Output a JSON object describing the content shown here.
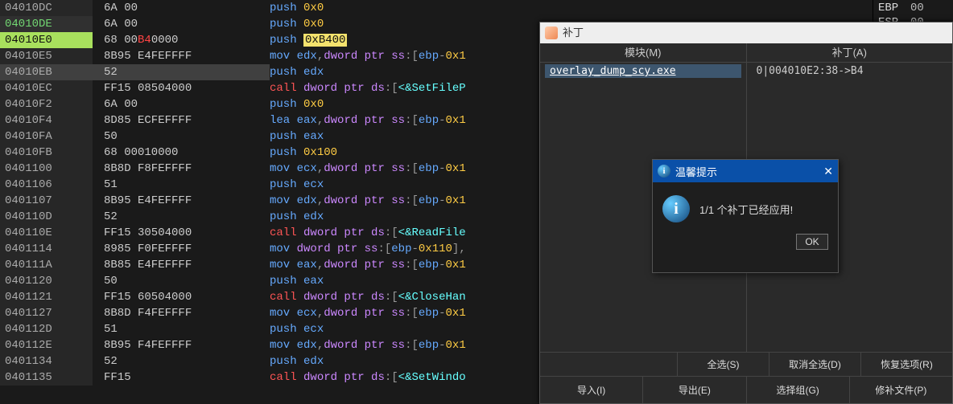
{
  "registers": [
    {
      "name": "EBP",
      "val": "00"
    },
    {
      "name": "ESP",
      "val": "00"
    }
  ],
  "rows": [
    {
      "addr": "04010DC",
      "bytes": "6A 00",
      "mn": "push",
      "op": "0x0",
      "cls": ""
    },
    {
      "addr": "04010DE",
      "bytes": "6A 00",
      "mn": "push",
      "op": "0x0",
      "cls": "bpline"
    },
    {
      "addr": "04010E0",
      "bytes_pre": "68 00",
      "bytes_red": "B4",
      "bytes_post": "0000",
      "mn": "push",
      "op_hl": "0xB400",
      "cls": "hl"
    },
    {
      "addr": "04010E5",
      "bytes": "8B95 E4FEFFFF",
      "mn": "mov",
      "op_mov": "edx,dword ptr ss:[ebp-0x1",
      "cls": ""
    },
    {
      "addr": "04010EB",
      "bytes": "52",
      "mn": "push",
      "op_reg": "edx",
      "cls": "sel"
    },
    {
      "addr": "04010EC",
      "bytes": "FF15 08504000",
      "mn": "call",
      "op_call": "dword ptr ds:[<&SetFileP",
      "cls": ""
    },
    {
      "addr": "04010F2",
      "bytes": "6A 00",
      "mn": "push",
      "op": "0x0",
      "cls": ""
    },
    {
      "addr": "04010F4",
      "bytes": "8D85 ECFEFFFF",
      "mn": "lea",
      "op_mov": "eax,dword ptr ss:[ebp-0x1",
      "cls": ""
    },
    {
      "addr": "04010FA",
      "bytes": "50",
      "mn": "push",
      "op_reg": "eax",
      "cls": ""
    },
    {
      "addr": "04010FB",
      "bytes": "68 00010000",
      "mn": "push",
      "op": "0x100",
      "cls": ""
    },
    {
      "addr": "0401100",
      "bytes": "8B8D F8FEFFFF",
      "mn": "mov",
      "op_mov": "ecx,dword ptr ss:[ebp-0x1",
      "cls": ""
    },
    {
      "addr": "0401106",
      "bytes": "51",
      "mn": "push",
      "op_reg": "ecx",
      "cls": ""
    },
    {
      "addr": "0401107",
      "bytes": "8B95 E4FEFFFF",
      "mn": "mov",
      "op_mov": "edx,dword ptr ss:[ebp-0x1",
      "cls": ""
    },
    {
      "addr": "040110D",
      "bytes": "52",
      "mn": "push",
      "op_reg": "edx",
      "cls": ""
    },
    {
      "addr": "040110E",
      "bytes": "FF15 30504000",
      "mn": "call",
      "op_call": "dword ptr ds:[<&ReadFile",
      "cls": ""
    },
    {
      "addr": "0401114",
      "bytes": "8985 F0FEFFFF",
      "mn": "mov",
      "op_mov_full": "dword ptr ss:[ebp-0x110],",
      "cls": ""
    },
    {
      "addr": "040111A",
      "bytes": "8B85 E4FEFFFF",
      "mn": "mov",
      "op_mov": "eax,dword ptr ss:[ebp-0x1",
      "cls": ""
    },
    {
      "addr": "0401120",
      "bytes": "50",
      "mn": "push",
      "op_reg": "eax",
      "cls": ""
    },
    {
      "addr": "0401121",
      "bytes": "FF15 60504000",
      "mn": "call",
      "op_call": "dword ptr ds:[<&CloseHan",
      "cls": ""
    },
    {
      "addr": "0401127",
      "bytes": "8B8D F4FEFFFF",
      "mn": "mov",
      "op_mov": "ecx,dword ptr ss:[ebp-0x1",
      "cls": ""
    },
    {
      "addr": "040112D",
      "bytes": "51",
      "mn": "push",
      "op_reg": "ecx",
      "cls": ""
    },
    {
      "addr": "040112E",
      "bytes": "8B95 F4FEFFFF",
      "mn": "mov",
      "op_mov": "edx,dword ptr ss:[ebp-0x1",
      "cls": ""
    },
    {
      "addr": "0401134",
      "bytes": "52",
      "mn": "push",
      "op_reg": "edx",
      "cls": ""
    },
    {
      "addr": "0401135",
      "bytes": "FF15",
      "mn": "call",
      "op_call": "dword ptr ds:[<&SetWindo",
      "cls": ""
    }
  ],
  "patch": {
    "title": "补丁",
    "col_module": "模块(M)",
    "col_patch": "补丁(A)",
    "module_item": "overlay_dump_scy.exe",
    "patch_item": "0|004010E2:38->B4",
    "btn_import": "导入(I)",
    "btn_export": "导出(E)",
    "btn_selall": "全选(S)",
    "btn_deselall": "取消全选(D)",
    "btn_restore": "恢复选项(R)",
    "btn_selgrp": "选择组(G)",
    "btn_patchfile": "修补文件(P)"
  },
  "msgbox": {
    "title": "温馨提示",
    "text": "1/1 个补丁已经应用!",
    "ok": "OK"
  }
}
